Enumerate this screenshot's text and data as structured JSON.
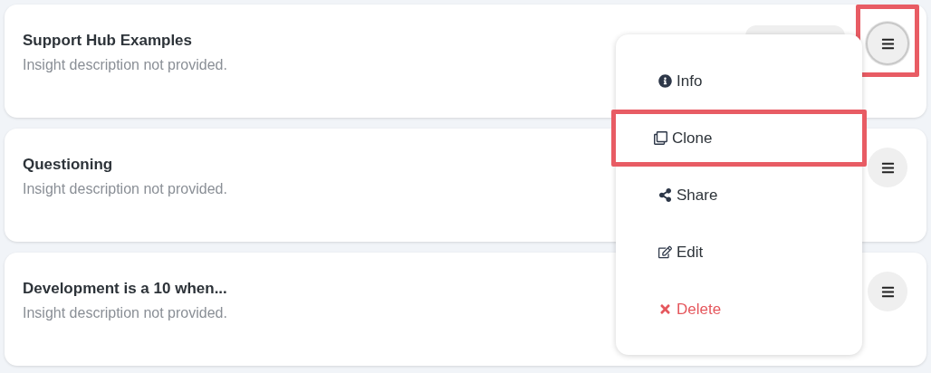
{
  "cards": [
    {
      "title": "Support Hub Examples",
      "description": "Insight description not provided.",
      "menu_focused": true,
      "highlighted": true
    },
    {
      "title": "Questioning",
      "description": "Insight description not provided.",
      "menu_focused": false,
      "highlighted": false
    },
    {
      "title": "Development is a 10 when...",
      "description": "Insight description not provided.",
      "menu_focused": false,
      "highlighted": false
    }
  ],
  "menu": {
    "items": [
      {
        "kind": "info",
        "label": "Info",
        "highlighted": false
      },
      {
        "kind": "clone",
        "label": "Clone",
        "highlighted": true
      },
      {
        "kind": "share",
        "label": "Share",
        "highlighted": false
      },
      {
        "kind": "edit",
        "label": "Edit",
        "highlighted": false
      },
      {
        "kind": "delete",
        "label": "Delete",
        "highlighted": false
      }
    ]
  }
}
